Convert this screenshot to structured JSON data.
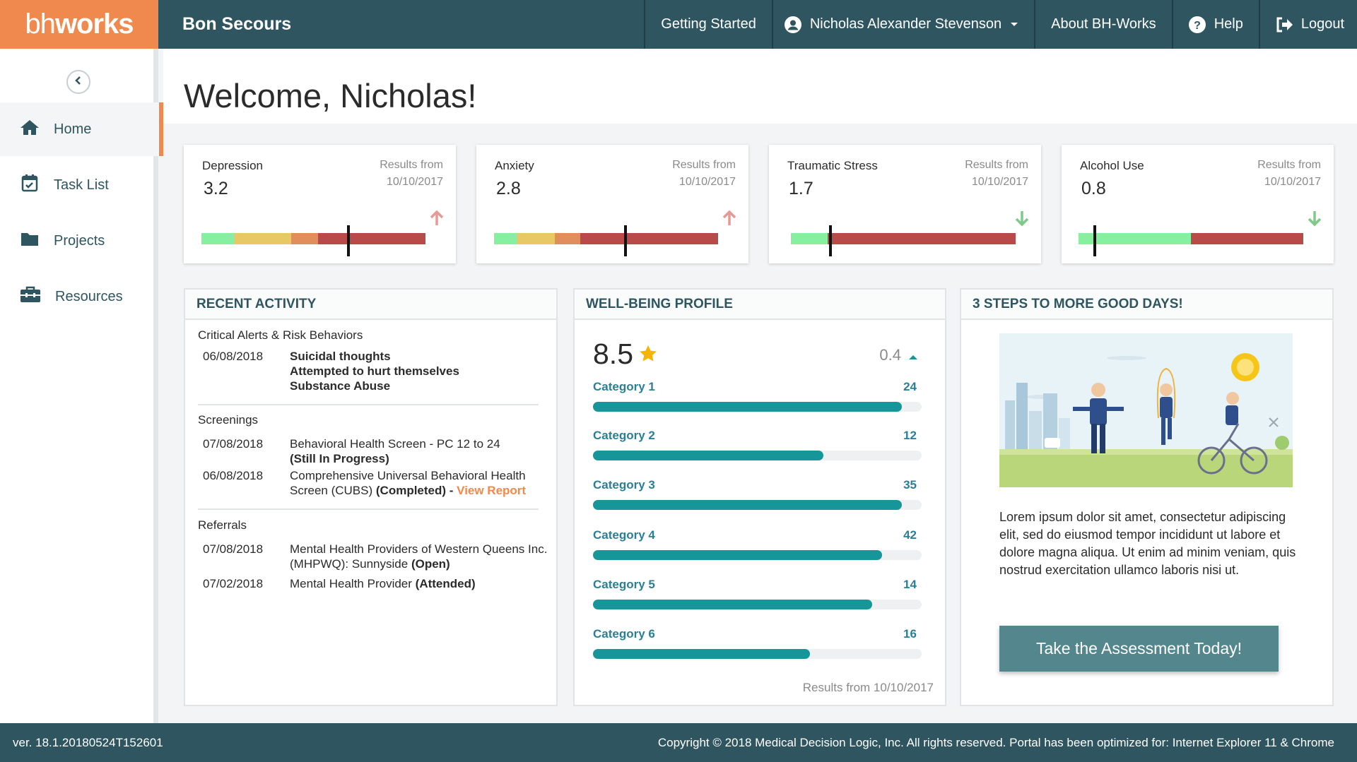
{
  "header": {
    "logo_light": "bh",
    "logo_bold": "works",
    "org_name": "Bon Secours",
    "nav": {
      "getting_started": "Getting Started",
      "user_name": "Nicholas Alexander Stevenson",
      "about": "About BH-Works",
      "help": "Help",
      "logout": "Logout"
    }
  },
  "sidebar": {
    "items": [
      {
        "label": "Home",
        "icon": "home-icon",
        "active": true
      },
      {
        "label": "Task List",
        "icon": "calendar-check-icon"
      },
      {
        "label": "Projects",
        "icon": "folder-icon"
      },
      {
        "label": "Resources",
        "icon": "toolbox-icon"
      }
    ]
  },
  "welcome": "Welcome, Nicholas!",
  "scores": [
    {
      "name": "Depression",
      "value": "3.2",
      "results_label": "Results from",
      "results_date": "10/10/2017",
      "trend": "up"
    },
    {
      "name": "Anxiety",
      "value": "2.8",
      "results_label": "Results from",
      "results_date": "10/10/2017",
      "trend": "up"
    },
    {
      "name": "Traumatic Stress",
      "value": "1.7",
      "results_label": "Results from",
      "results_date": "10/10/2017",
      "trend": "down"
    },
    {
      "name": "Alcohol Use",
      "value": "0.8",
      "results_label": "Results from",
      "results_date": "10/10/2017",
      "trend": "down"
    }
  ],
  "recent_activity": {
    "title": "RECENT ACTIVITY",
    "alerts_heading": "Critical Alerts & Risk Behaviors",
    "alert_date": "06/08/2018",
    "alert_lines": [
      "Suicidal thoughts",
      "Attempted to hurt themselves",
      "Substance Abuse"
    ],
    "screenings_heading": "Screenings",
    "screening_1_date": "07/08/2018",
    "screening_1_text": "Behavioral Health Screen - PC 12 to  24",
    "screening_1_status": "(Still In Progress)",
    "screening_2_date": "06/08/2018",
    "screening_2_text": "Comprehensive Universal Behavioral Health Screen (CUBS)",
    "screening_2_status": "(Completed) -",
    "screening_2_link": "View Report",
    "referrals_heading": "Referrals",
    "referral_1_date": "07/08/2018",
    "referral_1_text": "Mental Health Providers of Western Queens Inc. (MHPWQ): Sunnyside",
    "referral_1_status": "(Open)",
    "referral_2_date": "07/02/2018",
    "referral_2_text": "Mental Health Provider",
    "referral_2_status": "(Attended)"
  },
  "wellbeing": {
    "title": "WELL-BEING PROFILE",
    "score": "8.5",
    "change": "0.4",
    "categories": [
      {
        "label": "Category 1",
        "value": "24",
        "fill_pct": 94
      },
      {
        "label": "Category 2",
        "value": "12",
        "fill_pct": 70
      },
      {
        "label": "Category 3",
        "value": "35",
        "fill_pct": 94
      },
      {
        "label": "Category 4",
        "value": "42",
        "fill_pct": 88
      },
      {
        "label": "Category 5",
        "value": "14",
        "fill_pct": 85
      },
      {
        "label": "Category 6",
        "value": "16",
        "fill_pct": 66
      }
    ],
    "footer": "Results from 10/10/2017"
  },
  "steps": {
    "title": "3 STEPS TO MORE GOOD DAYS!",
    "body": "Lorem ipsum dolor sit amet, consectetur adipiscing elit, sed do eiusmod tempor incididunt ut labore et dolore magna aliqua. Ut enim ad minim veniam, quis nostrud exercitation ullamco laboris nisi ut.",
    "cta": "Take the Assessment Today!"
  },
  "footer": {
    "version": "ver. 18.1.20180524T152601",
    "copyright": "Copyright © 2018 Medical Decision Logic, Inc. All rights reserved. Portal has been optimized for: Internet Explorer 11 & Chrome"
  },
  "colors": {
    "brand_orange": "#f0894e",
    "header_teal": "#2e5560",
    "accent_teal": "#17969a",
    "risk_green": "#86efa0",
    "risk_yellow": "#e8c765",
    "risk_orange": "#df8e5c",
    "risk_red": "#b94a4a"
  }
}
